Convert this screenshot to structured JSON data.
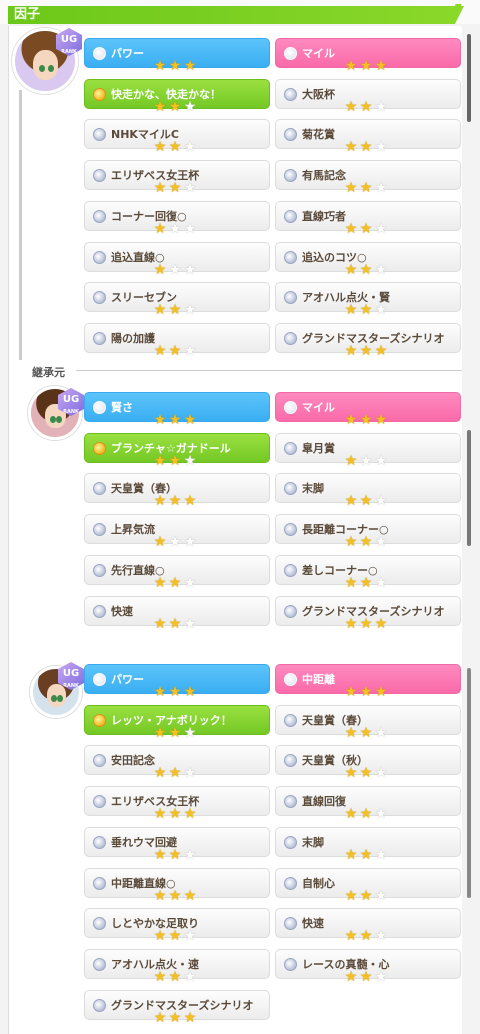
{
  "header": {
    "title": "因子"
  },
  "section_label": "継承元",
  "colors": {
    "blue": "#3aaef2",
    "pink": "#f96aa8",
    "green": "#74c825",
    "star": "#f4c020"
  },
  "characters": [
    {
      "rank": "UG",
      "rank_sub": "RANK",
      "left": [
        {
          "label": "パワー",
          "color": "blue",
          "stars": 3
        },
        {
          "label": "快走かな、快走かな！",
          "color": "green",
          "stars": 2
        },
        {
          "label": "NHKマイルC",
          "color": "white",
          "stars": 2
        },
        {
          "label": "エリザベス女王杯",
          "color": "white",
          "stars": 2
        },
        {
          "label": "コーナー回復○",
          "color": "white",
          "stars": 1
        },
        {
          "label": "追込直線○",
          "color": "white",
          "stars": 1
        },
        {
          "label": "スリーセブン",
          "color": "white",
          "stars": 2
        },
        {
          "label": "陽の加護",
          "color": "white",
          "stars": 2
        }
      ],
      "right": [
        {
          "label": "マイル",
          "color": "pink",
          "stars": 3
        },
        {
          "label": "大阪杯",
          "color": "white",
          "stars": 2
        },
        {
          "label": "菊花賞",
          "color": "white",
          "stars": 2
        },
        {
          "label": "有馬記念",
          "color": "white",
          "stars": 2
        },
        {
          "label": "直線巧者",
          "color": "white",
          "stars": 2
        },
        {
          "label": "追込のコツ○",
          "color": "white",
          "stars": 2
        },
        {
          "label": "アオハル点火・賢",
          "color": "white",
          "stars": 2
        },
        {
          "label": "グランドマスターズシナリオ",
          "color": "white",
          "stars": 3
        }
      ]
    },
    {
      "rank": "UG",
      "rank_sub": "RANK",
      "left": [
        {
          "label": "賢さ",
          "color": "blue",
          "stars": 3
        },
        {
          "label": "ブランチャ☆ガナドール",
          "color": "green",
          "stars": 2
        },
        {
          "label": "天皇賞（春）",
          "color": "white",
          "stars": 3
        },
        {
          "label": "上昇気流",
          "color": "white",
          "stars": 1
        },
        {
          "label": "先行直線○",
          "color": "white",
          "stars": 2
        },
        {
          "label": "快速",
          "color": "white",
          "stars": 2
        }
      ],
      "right": [
        {
          "label": "マイル",
          "color": "pink",
          "stars": 3
        },
        {
          "label": "皐月賞",
          "color": "white",
          "stars": 1
        },
        {
          "label": "末脚",
          "color": "white",
          "stars": 2
        },
        {
          "label": "長距離コーナー○",
          "color": "white",
          "stars": 2
        },
        {
          "label": "差しコーナー○",
          "color": "white",
          "stars": 2
        },
        {
          "label": "グランドマスターズシナリオ",
          "color": "white",
          "stars": 3
        }
      ]
    },
    {
      "rank": "UG",
      "rank_sub": "RANK",
      "left": [
        {
          "label": "パワー",
          "color": "blue",
          "stars": 3
        },
        {
          "label": "レッツ・アナボリック！",
          "color": "green",
          "stars": 2
        },
        {
          "label": "安田記念",
          "color": "white",
          "stars": 2
        },
        {
          "label": "エリザベス女王杯",
          "color": "white",
          "stars": 3
        },
        {
          "label": "垂れウマ回避",
          "color": "white",
          "stars": 2
        },
        {
          "label": "中距離直線○",
          "color": "white",
          "stars": 3
        },
        {
          "label": "しとやかな足取り",
          "color": "white",
          "stars": 2
        },
        {
          "label": "アオハル点火・速",
          "color": "white",
          "stars": 2
        },
        {
          "label": "グランドマスターズシナリオ",
          "color": "white",
          "stars": 3
        }
      ],
      "right": [
        {
          "label": "中距離",
          "color": "pink",
          "stars": 3
        },
        {
          "label": "天皇賞（春）",
          "color": "white",
          "stars": 2
        },
        {
          "label": "天皇賞（秋）",
          "color": "white",
          "stars": 2
        },
        {
          "label": "直線回復",
          "color": "white",
          "stars": 2
        },
        {
          "label": "末脚",
          "color": "white",
          "stars": 2
        },
        {
          "label": "自制心",
          "color": "white",
          "stars": 2
        },
        {
          "label": "快速",
          "color": "white",
          "stars": 2
        },
        {
          "label": "レースの真髄・心",
          "color": "white",
          "stars": 2
        }
      ]
    }
  ]
}
